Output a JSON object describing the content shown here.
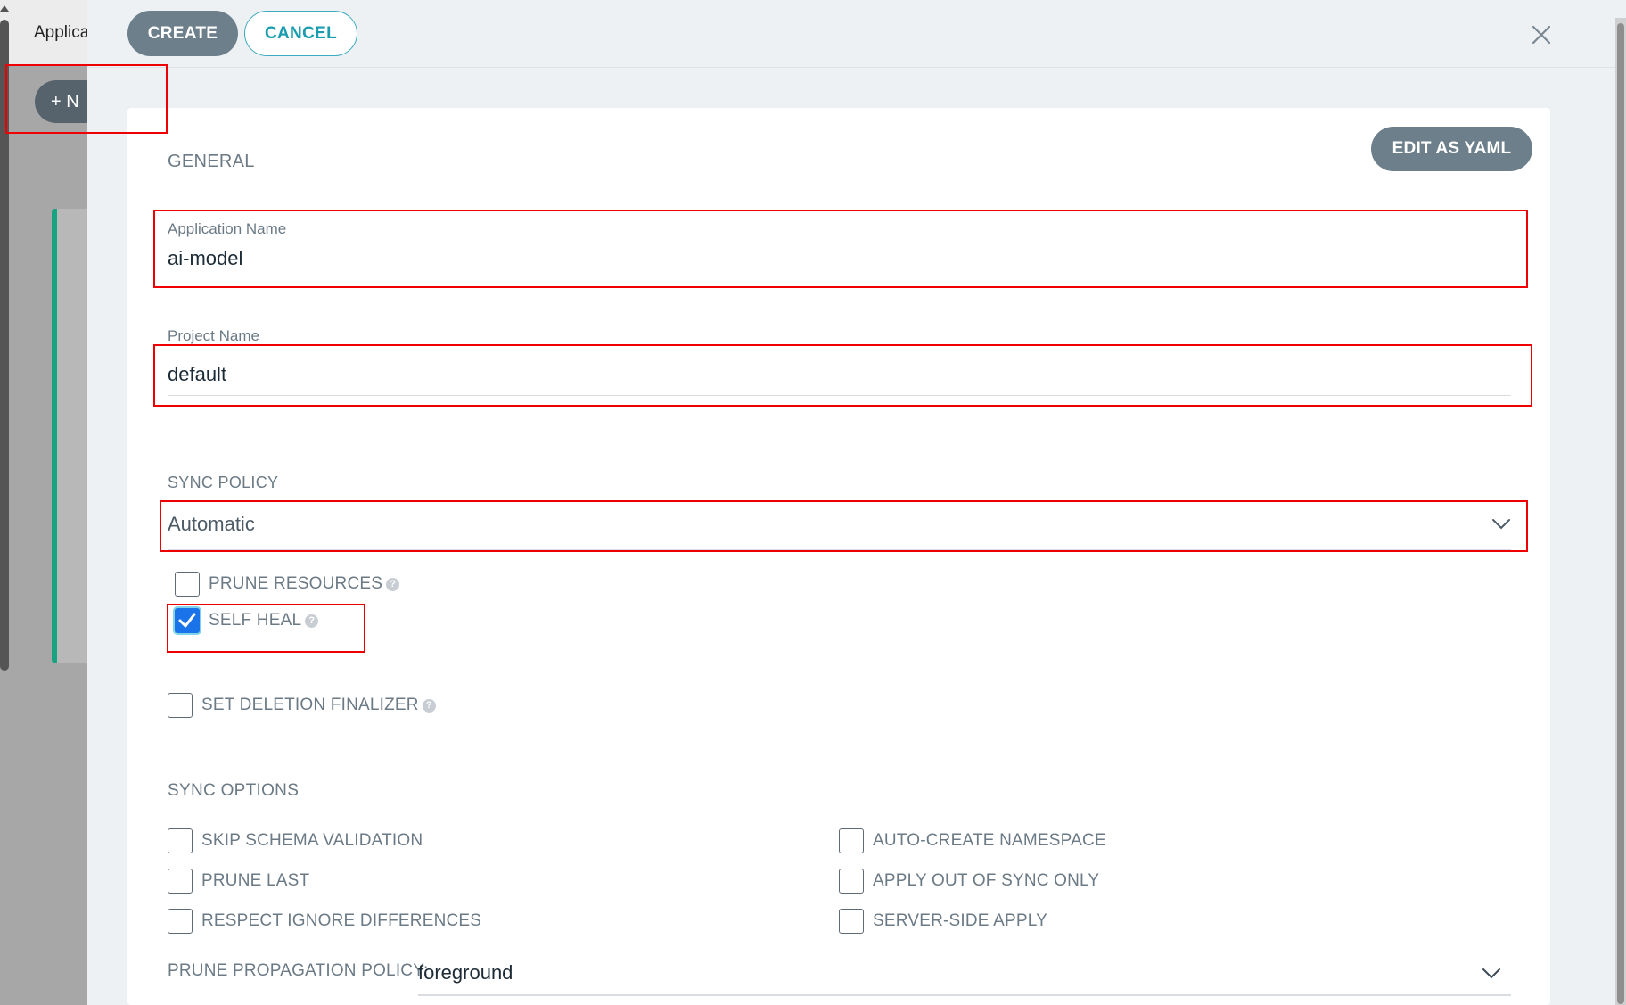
{
  "background": {
    "title": "Applica",
    "new_button": "+ N"
  },
  "toolbar": {
    "create_label": "CREATE",
    "cancel_label": "CANCEL"
  },
  "general": {
    "section_title": "GENERAL",
    "edit_yaml_label": "EDIT AS YAML",
    "application_name": {
      "label": "Application Name",
      "value": "ai-model"
    },
    "project_name": {
      "label": "Project Name",
      "value": "default"
    }
  },
  "sync_policy": {
    "section_title": "SYNC POLICY",
    "selected": "Automatic",
    "prune_resources": {
      "label": "PRUNE RESOURCES",
      "checked": false
    },
    "self_heal": {
      "label": "SELF HEAL",
      "checked": true
    },
    "set_deletion_finalizer": {
      "label": "SET DELETION FINALIZER",
      "checked": false
    }
  },
  "sync_options": {
    "section_title": "SYNC OPTIONS",
    "skip_schema_validation": "SKIP SCHEMA VALIDATION",
    "prune_last": "PRUNE LAST",
    "respect_ignore_differences": "RESPECT IGNORE DIFFERENCES",
    "auto_create_namespace": "AUTO-CREATE NAMESPACE",
    "apply_out_of_sync_only": "APPLY OUT OF SYNC ONLY",
    "server_side_apply": "SERVER-SIDE APPLY",
    "prune_propagation_policy": {
      "label": "PRUNE PROPAGATION POLICY:",
      "value": "foreground"
    }
  },
  "help_glyph": "?",
  "colors": {
    "accent_button": "#6d7f8b",
    "cancel_text": "#1a9cb0",
    "checkbox_checked": "#1a73e8",
    "annotation": "#ee0000",
    "app_status_green": "#17a37f"
  }
}
